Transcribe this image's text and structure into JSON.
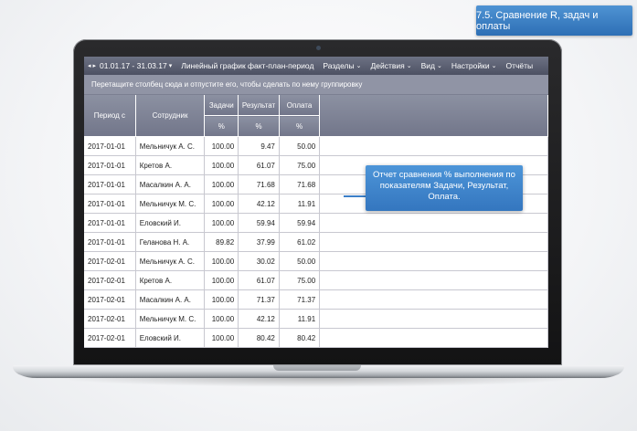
{
  "badge": "7.5. Сравнение R, задач и оплаты",
  "toolbar": {
    "date_range": "01.01.17 - 31.03.17",
    "chart_link": "Линейный график факт-план-период",
    "sections": "Разделы",
    "actions": "Действия",
    "view": "Вид",
    "settings": "Настройки",
    "reports": "Отчёты"
  },
  "group_hint": "Перетащите столбец сюда и отпустите его, чтобы сделать по нему группировку",
  "columns": {
    "period": "Период с",
    "employee": "Сотрудник",
    "tasks": "Задачи",
    "result": "Результат",
    "payment": "Оплата",
    "unit": "%"
  },
  "rows": [
    {
      "period": "2017-01-01",
      "employee": "Мельничук А. С.",
      "tasks": "100.00",
      "result": "9.47",
      "payment": "50.00"
    },
    {
      "period": "2017-01-01",
      "employee": "Кретов А.",
      "tasks": "100.00",
      "result": "61.07",
      "payment": "75.00"
    },
    {
      "period": "2017-01-01",
      "employee": "Масалкин А. А.",
      "tasks": "100.00",
      "result": "71.68",
      "payment": "71.68"
    },
    {
      "period": "2017-01-01",
      "employee": "Мельничук М. С.",
      "tasks": "100.00",
      "result": "42.12",
      "payment": "11.91"
    },
    {
      "period": "2017-01-01",
      "employee": "Еловский И.",
      "tasks": "100.00",
      "result": "59.94",
      "payment": "59.94"
    },
    {
      "period": "2017-01-01",
      "employee": "Геланова Н. А.",
      "tasks": "89.82",
      "result": "37.99",
      "payment": "61.02"
    },
    {
      "period": "2017-02-01",
      "employee": "Мельничук А. С.",
      "tasks": "100.00",
      "result": "30.02",
      "payment": "50.00"
    },
    {
      "period": "2017-02-01",
      "employee": "Кретов А.",
      "tasks": "100.00",
      "result": "61.07",
      "payment": "75.00"
    },
    {
      "period": "2017-02-01",
      "employee": "Масалкин А. А.",
      "tasks": "100.00",
      "result": "71.37",
      "payment": "71.37"
    },
    {
      "period": "2017-02-01",
      "employee": "Мельничук М. С.",
      "tasks": "100.00",
      "result": "42.12",
      "payment": "11.91"
    },
    {
      "period": "2017-02-01",
      "employee": "Еловский И.",
      "tasks": "100.00",
      "result": "80.42",
      "payment": "80.42"
    }
  ],
  "tooltip": "Отчет сравнения % выполнения по показателям Задачи, Результат, Оплата."
}
